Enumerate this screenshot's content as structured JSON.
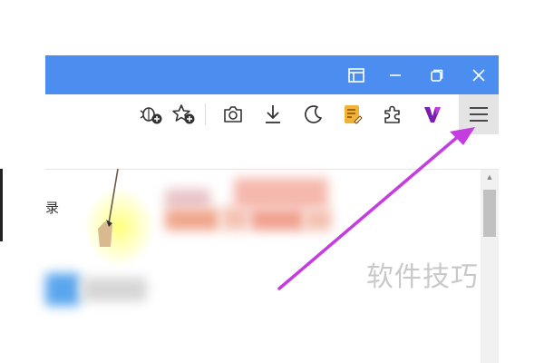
{
  "colors": {
    "titlebar": "#4b8ef0",
    "annotation_arrow": "#c53ce0",
    "menu_highlight": "#e4e4e4",
    "vip_icon": "#7a1fb0",
    "notes_icon": "#f2b23a"
  },
  "window_controls": [
    {
      "name": "sidebar-layout-icon"
    },
    {
      "name": "minimize-icon"
    },
    {
      "name": "restore-icon"
    },
    {
      "name": "close-icon"
    }
  ],
  "toolbar": {
    "icons": [
      "bug-add-icon",
      "star-add-icon",
      "camera-icon",
      "download-icon",
      "moon-icon",
      "notes-icon",
      "puzzle-icon",
      "vip-icon",
      "hamburger-menu-icon"
    ]
  },
  "content": {
    "partial_char": "录"
  },
  "watermark": "软件技巧"
}
